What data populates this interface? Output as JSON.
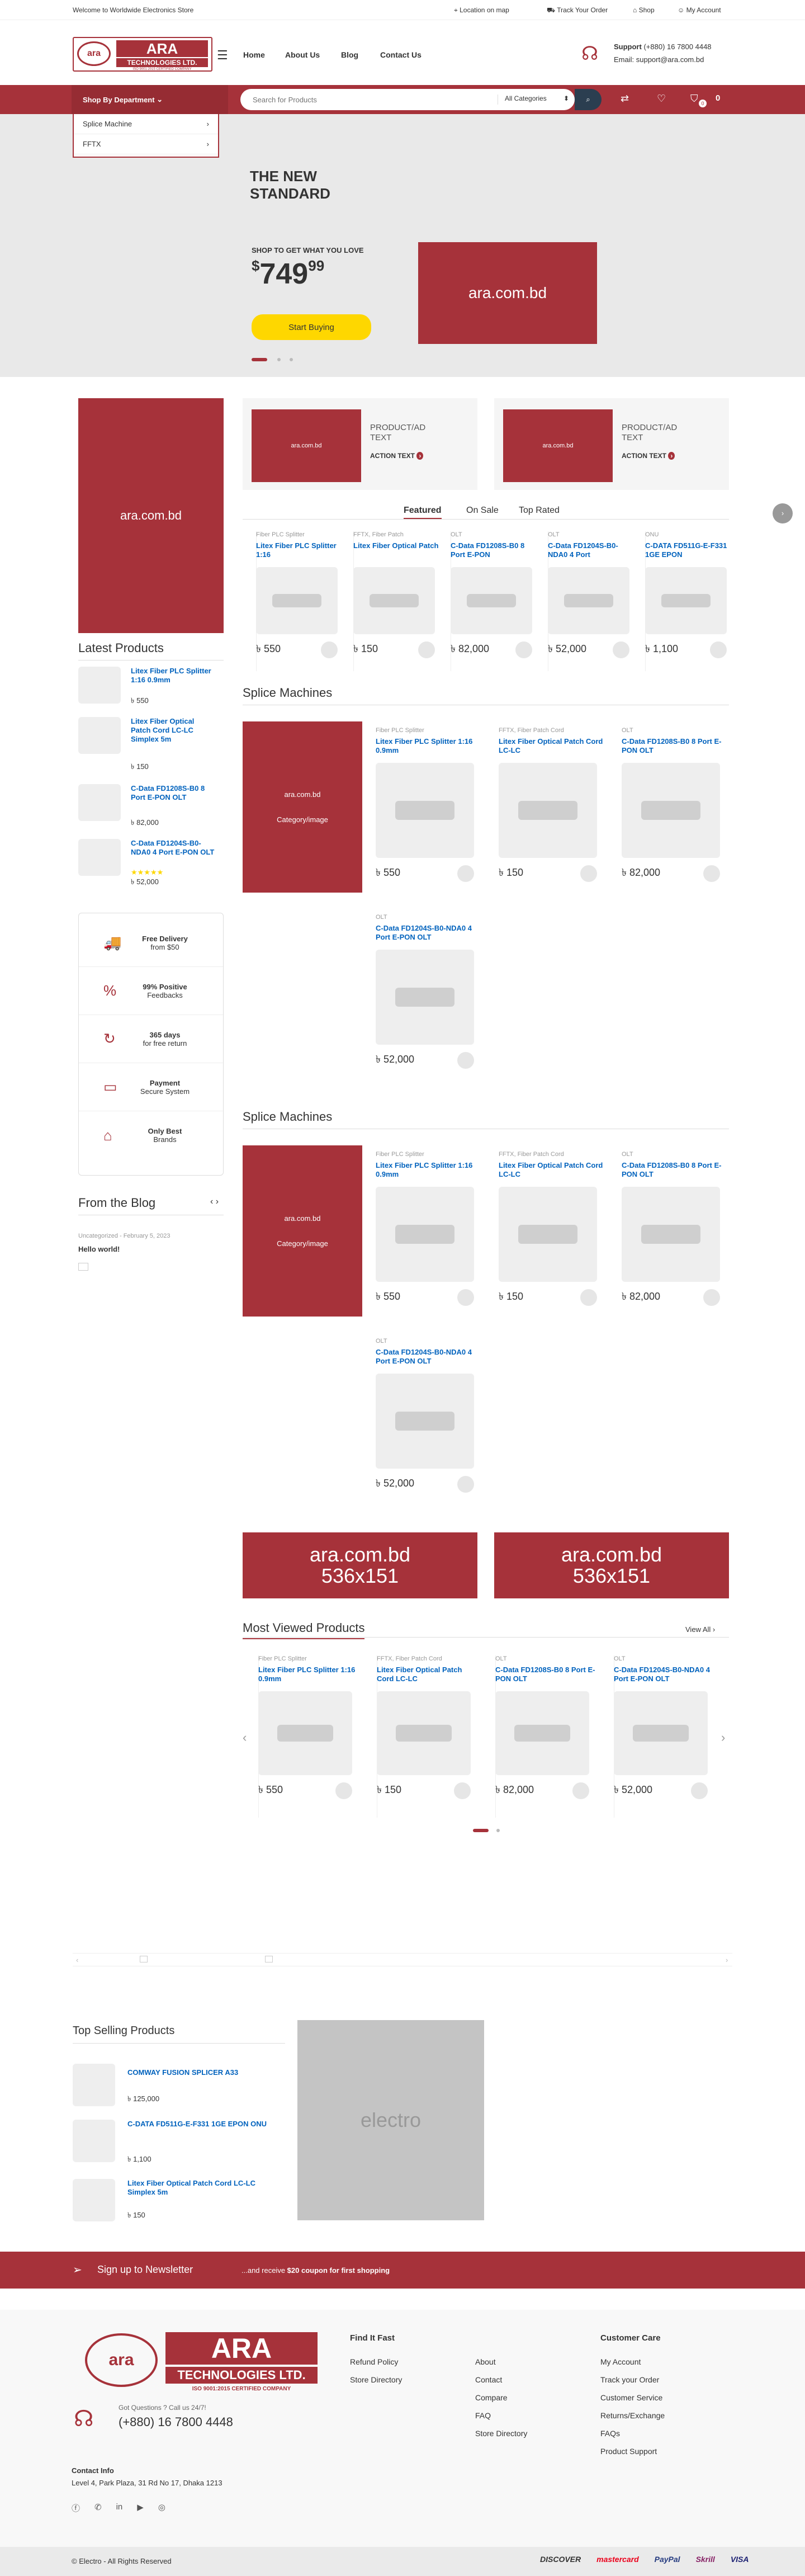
{
  "topbar": {
    "welcome": "Welcome to Worldwide Electronics Store",
    "location": "Location on map",
    "track": "Track Your Order",
    "shop": "Shop",
    "account": "My Account"
  },
  "logo": {
    "big": "ARA",
    "sub": "TECHNOLOGIES LTD.",
    "tagline": "ISO 9001:2015 CERTIFIED COMPANY"
  },
  "nav": [
    "Home",
    "About Us",
    "Blog",
    "Contact Us"
  ],
  "support": {
    "label": "Support",
    "phone": "(+880) 16 7800 4448",
    "email": "Email: support@ara.com.bd"
  },
  "header_counts": {
    "cart": "0",
    "cart_total": "0"
  },
  "dept": {
    "label": "Shop By Department",
    "items": [
      "Splice Machine",
      "FFTX"
    ]
  },
  "search": {
    "placeholder": "Search for Products",
    "category": "All Categories"
  },
  "hero": {
    "line1": "THE NEW",
    "line2": "STANDARD",
    "sub": "SHOP TO GET WHAT YOU LOVE",
    "price_currency": "$",
    "price_main": "749",
    "price_cents": "99",
    "button": "Start Buying",
    "banner": "ara.com.bd"
  },
  "left_banner": "ara.com.bd",
  "ads": [
    {
      "img": "ara.com.bd",
      "text": "PRODUCT/AD TEXT",
      "action": "ACTION TEXT"
    },
    {
      "img": "ara.com.bd",
      "text": "PRODUCT/AD TEXT",
      "action": "ACTION TEXT"
    }
  ],
  "tabs": [
    "Featured",
    "On Sale",
    "Top Rated"
  ],
  "featured": [
    {
      "cat": "Fiber PLC Splitter",
      "title": "Litex Fiber PLC Splitter 1:16",
      "price": "550"
    },
    {
      "cat": "FFTX, Fiber Patch",
      "title": "Litex Fiber Optical Patch",
      "price": "150"
    },
    {
      "cat": "OLT",
      "title": "C-Data FD1208S-B0 8 Port E-PON",
      "price": "82,000"
    },
    {
      "cat": "OLT",
      "title": "C-Data FD1204S-B0-NDA0 4 Port",
      "price": "52,000"
    },
    {
      "cat": "ONU",
      "title": "C-DATA FD511G-E-F331 1GE EPON",
      "price": "1,100"
    }
  ],
  "latest": {
    "title": "Latest Products",
    "items": [
      {
        "title": "Litex Fiber PLC Splitter 1:16 0.9mm",
        "price": "550"
      },
      {
        "title": "Litex Fiber Optical Patch Cord LC-LC Simplex 5m",
        "price": "150"
      },
      {
        "title": "C-Data FD1208S-B0 8 Port E-PON OLT",
        "price": "82,000"
      },
      {
        "title": "C-Data FD1204S-B0-NDA0 4 Port E-PON OLT",
        "price": "52,000",
        "stars": "★★★★★"
      }
    ]
  },
  "features": [
    {
      "icon": "truck-icon",
      "glyph": "🚚",
      "bold": "Free Delivery",
      "light": "from $50"
    },
    {
      "icon": "percent-icon",
      "glyph": "%",
      "bold": "99% Positive",
      "light": "Feedbacks"
    },
    {
      "icon": "return-icon",
      "glyph": "↻",
      "bold": "365 days",
      "light": "for free return"
    },
    {
      "icon": "payment-icon",
      "glyph": "▭",
      "bold": "Payment",
      "light": "Secure System"
    },
    {
      "icon": "tag-icon",
      "glyph": "⌂",
      "bold": "Only Best",
      "light": "Brands"
    }
  ],
  "blog": {
    "title": "From the Blog",
    "meta": "Uncategorized - February 5, 2023",
    "post": "Hello world!"
  },
  "splice1": {
    "title": "Splice Machines",
    "banner": "ara.com.bd",
    "banner_sub": "Category/image",
    "products": [
      {
        "cat": "Fiber PLC Splitter",
        "title": "Litex Fiber PLC Splitter 1:16 0.9mm",
        "price": "550"
      },
      {
        "cat": "FFTX, Fiber Patch Cord",
        "title": "Litex Fiber Optical Patch Cord LC-LC",
        "price": "150"
      },
      {
        "cat": "OLT",
        "title": "C-Data FD1208S-B0 8 Port E-PON OLT",
        "price": "82,000"
      },
      {
        "cat": "OLT",
        "title": "C-Data FD1204S-B0-NDA0 4 Port E-PON OLT",
        "price": "52,000"
      }
    ]
  },
  "splice2": {
    "title": "Splice Machines",
    "banner": "ara.com.bd",
    "banner_sub": "Category/image",
    "products": [
      {
        "cat": "Fiber PLC Splitter",
        "title": "Litex Fiber PLC Splitter 1:16 0.9mm",
        "price": "550"
      },
      {
        "cat": "FFTX, Fiber Patch Cord",
        "title": "Litex Fiber Optical Patch Cord LC-LC",
        "price": "150"
      },
      {
        "cat": "OLT",
        "title": "C-Data FD1208S-B0 8 Port E-PON OLT",
        "price": "82,000"
      },
      {
        "cat": "OLT",
        "title": "C-Data FD1204S-B0-NDA0 4 Port E-PON OLT",
        "price": "52,000"
      }
    ]
  },
  "banners": [
    {
      "l1": "ara.com.bd",
      "l2": "536x151"
    },
    {
      "l1": "ara.com.bd",
      "l2": "536x151"
    }
  ],
  "most_viewed": {
    "title": "Most Viewed Products",
    "view_all": "View All",
    "products": [
      {
        "cat": "Fiber PLC Splitter",
        "title": "Litex Fiber PLC Splitter 1:16 0.9mm",
        "price": "550"
      },
      {
        "cat": "FFTX, Fiber Patch Cord",
        "title": "Litex Fiber Optical Patch Cord LC-LC",
        "price": "150"
      },
      {
        "cat": "OLT",
        "title": "C-Data FD1208S-B0 8 Port E-PON OLT",
        "price": "82,000"
      },
      {
        "cat": "OLT",
        "title": "C-Data FD1204S-B0-NDA0 4 Port E-PON OLT",
        "price": "52,000"
      }
    ]
  },
  "top_selling": {
    "title": "Top Selling Products",
    "items": [
      {
        "title": "COMWAY FUSION SPLICER A33",
        "price": "125,000"
      },
      {
        "title": "C-DATA FD511G-E-F331 1GE EPON ONU",
        "price": "1,100"
      },
      {
        "title": "Litex Fiber Optical Patch Cord LC-LC Simplex 5m",
        "price": "150"
      }
    ]
  },
  "electro": "electro",
  "newsletter": {
    "title": "Sign up to Newsletter",
    "pre": "...and receive ",
    "bold": "$20 coupon for first shopping"
  },
  "footer": {
    "questions": "Got Questions ? Call us 24/7!",
    "phone": "(+880) 16 7800 4448",
    "contact_title": "Contact Info",
    "address": "Level 4, Park Plaza, 31 Rd No 17, Dhaka 1213",
    "find_title": "Find It Fast",
    "find": [
      "Refund Policy",
      "Store Directory"
    ],
    "col2": [
      "About",
      "Contact",
      "Compare",
      "FAQ",
      "Store Directory"
    ],
    "care_title": "Customer Care",
    "care": [
      "My Account",
      "Track your Order",
      "Customer Service",
      "Returns/Exchange",
      "FAQs",
      "Product Support"
    ],
    "copyright": "© Electro - All Rights Reserved",
    "payments": [
      "DISCOVER",
      "mastercard",
      "PayPal",
      "Skrill",
      "VISA"
    ]
  },
  "colors": {
    "brand": "#a6323a",
    "link": "#0062bd",
    "accent": "#fed700",
    "dark": "#2b3e50"
  }
}
